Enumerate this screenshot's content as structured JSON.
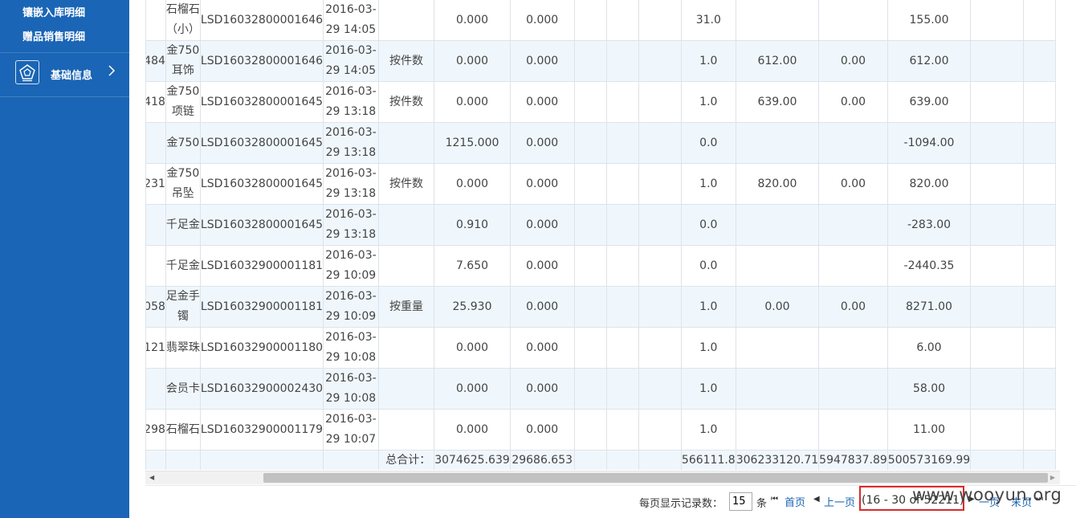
{
  "sidebar": {
    "sub_items": [
      {
        "label": "镶嵌入库明细"
      },
      {
        "label": "赠品销售明细"
      }
    ],
    "main_items": [
      {
        "label": "基础信息",
        "icon": "pentagon-badge-icon"
      }
    ]
  },
  "table": {
    "rows": [
      {
        "c0": "",
        "c1": "石榴石（小）",
        "c2": "LSD16032800001646",
        "c3": "2016-03-29 14:05",
        "c4": "",
        "c5": "0.000",
        "c6": "0.000",
        "c7": "",
        "c8": "",
        "c9": "",
        "c10": "31.0",
        "c11": "",
        "c12": "",
        "c13": "155.00"
      },
      {
        "c0": "484",
        "c1": "金750耳饰",
        "c2": "LSD16032800001646",
        "c3": "2016-03-29 14:05",
        "c4": "按件数",
        "c5": "0.000",
        "c6": "0.000",
        "c7": "",
        "c8": "",
        "c9": "",
        "c10": "1.0",
        "c11": "612.00",
        "c12": "0.00",
        "c13": "612.00"
      },
      {
        "c0": "418",
        "c1": "金750项链",
        "c2": "LSD16032800001645",
        "c3": "2016-03-29 13:18",
        "c4": "按件数",
        "c5": "0.000",
        "c6": "0.000",
        "c7": "",
        "c8": "",
        "c9": "",
        "c10": "1.0",
        "c11": "639.00",
        "c12": "0.00",
        "c13": "639.00"
      },
      {
        "c0": "",
        "c1": "金750",
        "c2": "LSD16032800001645",
        "c3": "2016-03-29 13:18",
        "c4": "",
        "c5": "1215.000",
        "c6": "0.000",
        "c7": "",
        "c8": "",
        "c9": "",
        "c10": "0.0",
        "c11": "",
        "c12": "",
        "c13": "-1094.00"
      },
      {
        "c0": "231",
        "c1": "金750吊坠",
        "c2": "LSD16032800001645",
        "c3": "2016-03-29 13:18",
        "c4": "按件数",
        "c5": "0.000",
        "c6": "0.000",
        "c7": "",
        "c8": "",
        "c9": "",
        "c10": "1.0",
        "c11": "820.00",
        "c12": "0.00",
        "c13": "820.00"
      },
      {
        "c0": "",
        "c1": "千足金",
        "c2": "LSD16032800001645",
        "c3": "2016-03-29 13:18",
        "c4": "",
        "c5": "0.910",
        "c6": "0.000",
        "c7": "",
        "c8": "",
        "c9": "",
        "c10": "0.0",
        "c11": "",
        "c12": "",
        "c13": "-283.00"
      },
      {
        "c0": "",
        "c1": "千足金",
        "c2": "LSD16032900001181",
        "c3": "2016-03-29 10:09",
        "c4": "",
        "c5": "7.650",
        "c6": "0.000",
        "c7": "",
        "c8": "",
        "c9": "",
        "c10": "0.0",
        "c11": "",
        "c12": "",
        "c13": "-2440.35"
      },
      {
        "c0": "058",
        "c1": "足金手镯",
        "c2": "LSD16032900001181",
        "c3": "2016-03-29 10:09",
        "c4": "按重量",
        "c5": "25.930",
        "c6": "0.000",
        "c7": "",
        "c8": "",
        "c9": "",
        "c10": "1.0",
        "c11": "0.00",
        "c12": "0.00",
        "c13": "8271.00"
      },
      {
        "c0": "121",
        "c1": "翡翠珠",
        "c2": "LSD16032900001180",
        "c3": "2016-03-29 10:08",
        "c4": "",
        "c5": "0.000",
        "c6": "0.000",
        "c7": "",
        "c8": "",
        "c9": "",
        "c10": "1.0",
        "c11": "",
        "c12": "",
        "c13": "6.00"
      },
      {
        "c0": "",
        "c1": "会员卡",
        "c2": "LSD16032900002430",
        "c3": "2016-03-29 10:08",
        "c4": "",
        "c5": "0.000",
        "c6": "0.000",
        "c7": "",
        "c8": "",
        "c9": "",
        "c10": "1.0",
        "c11": "",
        "c12": "",
        "c13": "58.00"
      },
      {
        "c0": "298",
        "c1": "石榴石",
        "c2": "LSD16032900001179",
        "c3": "2016-03-29 10:07",
        "c4": "",
        "c5": "0.000",
        "c6": "0.000",
        "c7": "",
        "c8": "",
        "c9": "",
        "c10": "1.0",
        "c11": "",
        "c12": "",
        "c13": "11.00"
      }
    ],
    "total": {
      "label": "总合计：",
      "c5": "3074625.639",
      "c6": "29686.653",
      "c10": "566111.8",
      "c11": "306233120.71",
      "c12": "5947837.89",
      "c13": "500573169.99"
    }
  },
  "pager": {
    "page_size_label": "每页显示记录数：",
    "page_size": "15",
    "unit": "条",
    "first": "首页",
    "prev": "上一页",
    "info": "(16 - 30 of 52211)",
    "next": "一页",
    "last": "末页"
  },
  "watermark": "www.wooyun.org",
  "colors": {
    "sidebar_bg": "#1a65b5",
    "row_alt": "#f0f7fc",
    "link": "#1a65b5",
    "highlight": "#d92a2a"
  }
}
